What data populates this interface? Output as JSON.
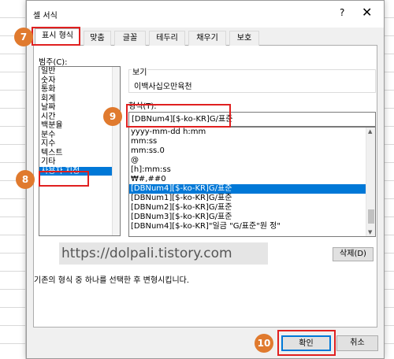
{
  "dialog": {
    "title": "셀 서식",
    "help_glyph": "?",
    "close_glyph": "✕"
  },
  "tabs": [
    {
      "label": "표시 형식",
      "active": true
    },
    {
      "label": "맞춤"
    },
    {
      "label": "글꼴"
    },
    {
      "label": "테두리"
    },
    {
      "label": "채우기"
    },
    {
      "label": "보호"
    }
  ],
  "category": {
    "label": "범주(C):",
    "items": [
      "일반",
      "숫자",
      "통화",
      "회계",
      "날짜",
      "시간",
      "백분율",
      "분수",
      "지수",
      "텍스트",
      "기타",
      "사용자 지정"
    ],
    "selected_index": 11
  },
  "sample": {
    "label": "보기",
    "value": "이백사십오만육천"
  },
  "format": {
    "label": "형식(T):",
    "value": "[DBNum4][$-ko-KR]G/표준",
    "items": [
      "yyyy-mm-dd h:mm",
      "mm:ss",
      "mm:ss.0",
      "@",
      "[h]:mm:ss",
      "₩#,##0",
      "[DBNum4][$-ko-KR]G/표준",
      "[DBNum1][$-ko-KR]G/표준",
      "[DBNum2][$-ko-KR]G/표준",
      "[DBNum3][$-ko-KR]G/표준",
      "[DBNum4][$-ko-KR]\"일금 \"G/표준\"원 정\""
    ],
    "selected_index": 6
  },
  "buttons": {
    "delete": "삭제(D)",
    "ok": "확인",
    "cancel": "취소"
  },
  "hint": "기존의 형식 중 하나를 선택한 후 변형시킵니다.",
  "watermark": "https://dolpali.tistory.com",
  "markers": [
    "7",
    "8",
    "9",
    "10"
  ],
  "colors": {
    "accent": "#0078d7",
    "marker": "#e07a2e",
    "highlight_box": "#e02020"
  }
}
